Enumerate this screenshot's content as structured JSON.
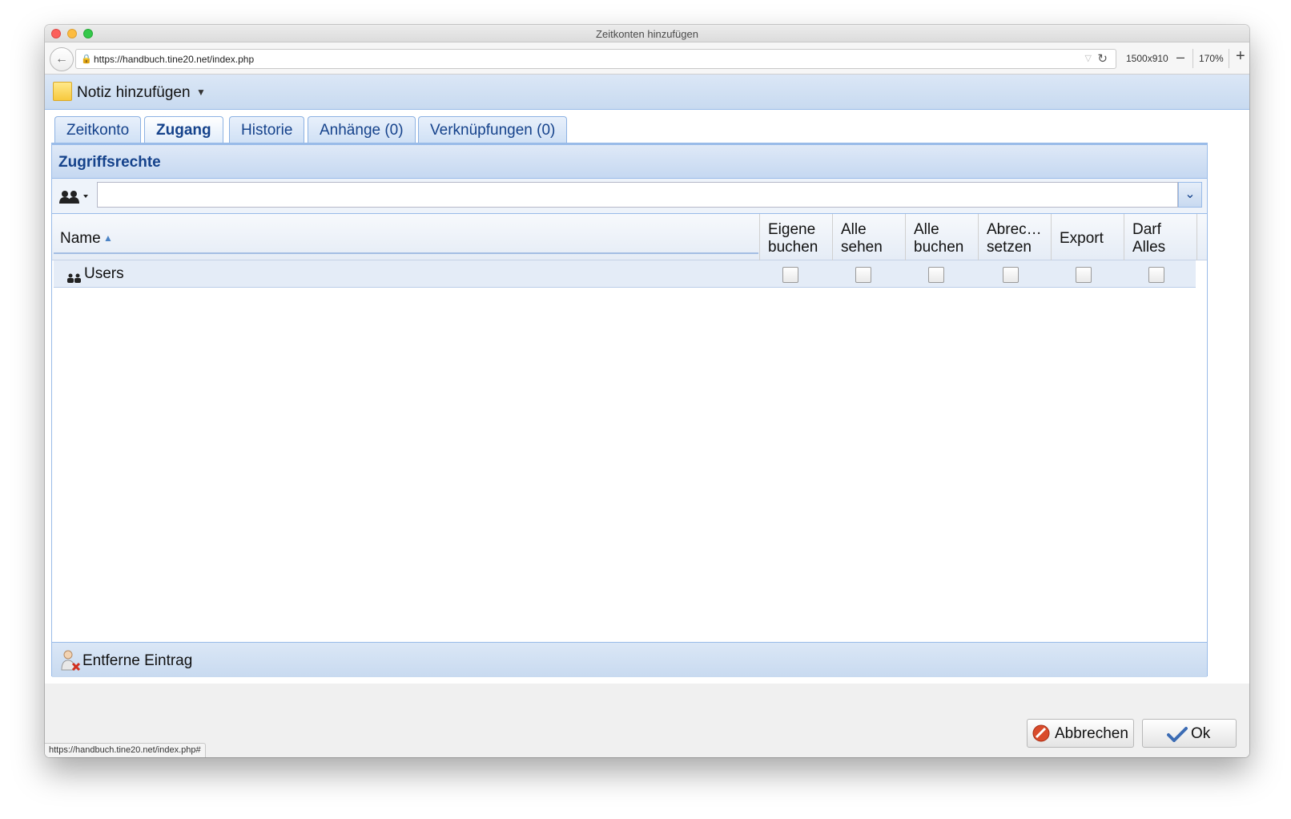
{
  "window": {
    "title": "Zeitkonten hinzufügen"
  },
  "browser": {
    "url": "https://handbuch.tine20.net/index.php",
    "dimensions": "1500x910",
    "zoom_level": "170%",
    "zoom_minus": "–",
    "zoom_plus": "+",
    "status_url": "https://handbuch.tine20.net/index.php#"
  },
  "toolbar": {
    "note_label": "Notiz hinzufügen"
  },
  "tabs": [
    {
      "label": "Zeitkonto",
      "active": false
    },
    {
      "label": "Zugang",
      "active": true
    },
    {
      "label": "Historie",
      "active": false
    },
    {
      "label": "Anhänge (0)",
      "active": false
    },
    {
      "label": "Verknüpfungen (0)",
      "active": false
    }
  ],
  "panel": {
    "title": "Zugriffsrechte",
    "search_value": ""
  },
  "grid": {
    "name_header": "Name",
    "columns": [
      {
        "line1": "Eigene",
        "line2": "buchen"
      },
      {
        "line1": "Alle",
        "line2": "sehen"
      },
      {
        "line1": "Alle",
        "line2": "buchen"
      },
      {
        "line1": "Abrec…",
        "line2": "setzen"
      },
      {
        "line1": "Export",
        "line2": ""
      },
      {
        "line1": "Darf",
        "line2": "Alles"
      }
    ],
    "rows": [
      {
        "name": "Users",
        "checks": [
          false,
          false,
          false,
          false,
          false,
          false
        ]
      }
    ]
  },
  "footer": {
    "remove_label": "Entferne Eintrag"
  },
  "buttons": {
    "cancel": "Abbrechen",
    "ok": "Ok"
  },
  "colors": {
    "accent": "#15428b",
    "border": "#99bbe8",
    "header_bg": "#c8daf0"
  }
}
